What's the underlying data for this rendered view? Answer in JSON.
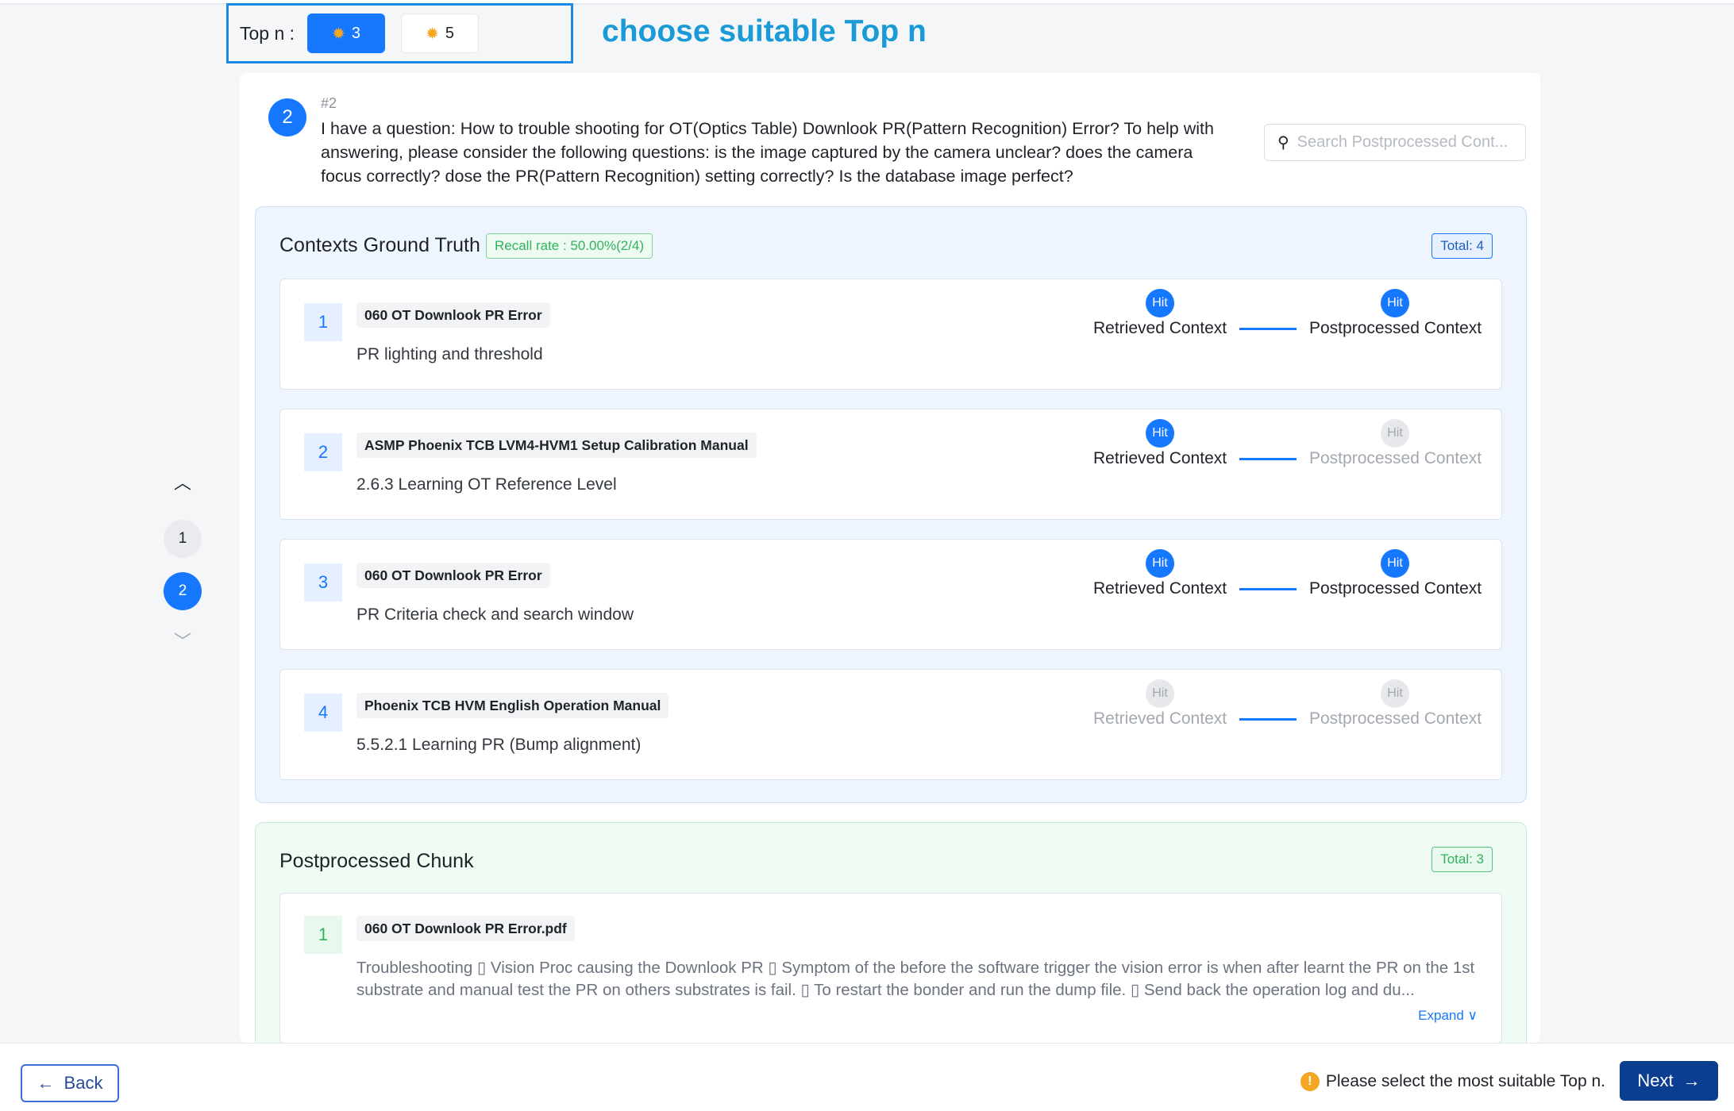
{
  "topn": {
    "label": "Top n :",
    "options": [
      {
        "value": "3",
        "icon": "gear-icon",
        "selected": true
      },
      {
        "value": "5",
        "icon": "gear-icon",
        "selected": false
      }
    ],
    "annotation": "choose suitable Top n"
  },
  "question": {
    "badge": "2",
    "number": "#2",
    "text": "I have a question: How to trouble shooting for OT(Optics Table) Downlook PR(Pattern Recognition) Error? To help with answering, please consider the following questions: is the image captured by the camera unclear? does the camera focus correctly? dose the PR(Pattern Recognition) setting correctly? Is the database image perfect?"
  },
  "search": {
    "placeholder": "Search Postprocessed Cont..."
  },
  "ground_truth": {
    "title": "Contexts Ground Truth",
    "recall": "Recall rate : 50.00%(2/4)",
    "total": "Total: 4",
    "hit_label": "Hit",
    "retrieved_label": "Retrieved Context",
    "postprocessed_label": "Postprocessed Context",
    "rows": [
      {
        "index": "1",
        "tag": "060 OT Downlook PR Error",
        "desc": "PR lighting and threshold",
        "retrieved_hit": true,
        "postprocessed_hit": true
      },
      {
        "index": "2",
        "tag": "ASMP Phoenix TCB LVM4-HVM1 Setup Calibration Manual",
        "desc": "2.6.3 Learning OT Reference Level",
        "retrieved_hit": true,
        "postprocessed_hit": false
      },
      {
        "index": "3",
        "tag": "060 OT Downlook PR Error",
        "desc": "PR Criteria check and search window",
        "retrieved_hit": true,
        "postprocessed_hit": true
      },
      {
        "index": "4",
        "tag": "Phoenix TCB HVM English Operation Manual",
        "desc": "5.5.2.1 Learning PR (Bump alignment)",
        "retrieved_hit": false,
        "postprocessed_hit": false
      }
    ]
  },
  "postprocessed": {
    "title": "Postprocessed Chunk",
    "total": "Total: 3",
    "rows": [
      {
        "index": "1",
        "tag": "060 OT Downlook PR Error.pdf",
        "text": "Troubleshooting ▯ Vision Proc causing the Downlook PR ▯ Symptom of the before the software trigger the vision error is when after learnt the PR on the 1st substrate and manual test the PR on others substrates is fail. ▯ To restart the bonder and run the dump file. ▯ Send back the operation log and du...",
        "expand": "Expand ∨"
      }
    ]
  },
  "side_nav": {
    "items": [
      {
        "label": "1",
        "active": false
      },
      {
        "label": "2",
        "active": true
      }
    ]
  },
  "footer": {
    "back": "Back",
    "hint": "Please select the most suitable Top n.",
    "next": "Next"
  },
  "colors": {
    "accent": "#1677ff",
    "annotation": "#1a9bd7",
    "next_bg": "#0b3d91",
    "recall_green": "#2fb45b"
  }
}
